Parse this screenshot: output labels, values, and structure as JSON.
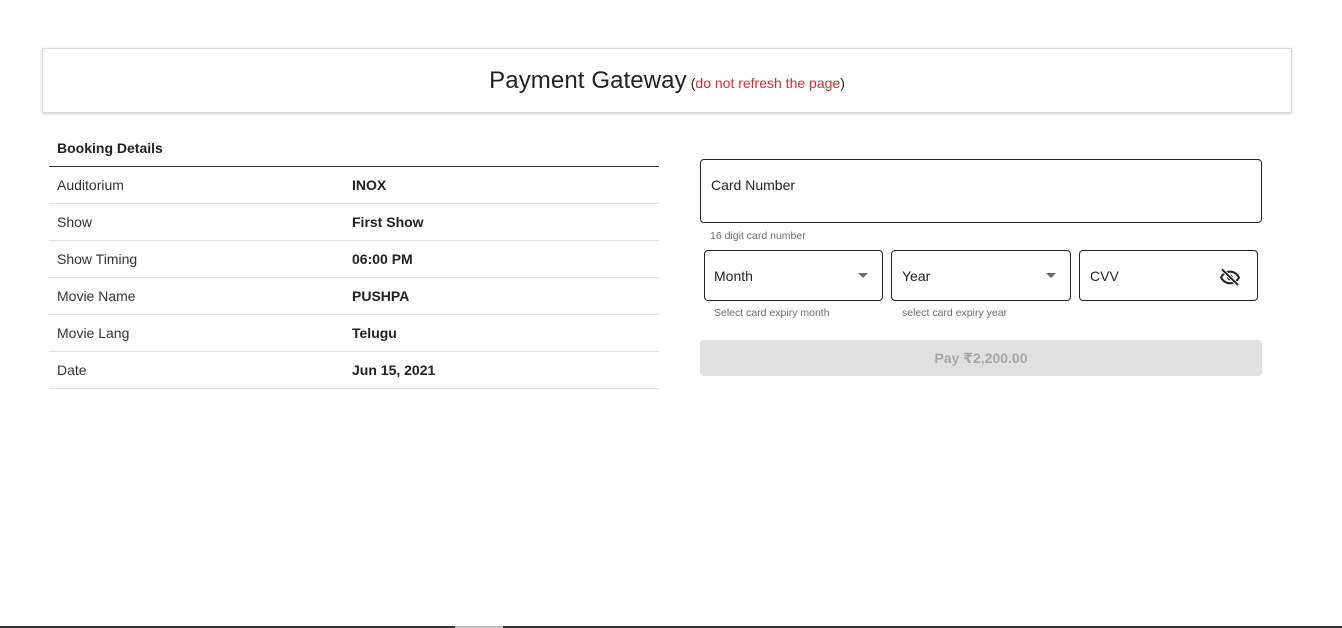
{
  "header": {
    "title": "Payment Gateway",
    "note_open": "(",
    "note_warning": "do not refresh the page",
    "note_close": ")"
  },
  "booking": {
    "heading": "Booking Details",
    "rows": [
      {
        "label": "Auditorium",
        "value": "INOX"
      },
      {
        "label": "Show",
        "value": "First Show"
      },
      {
        "label": "Show Timing",
        "value": "06:00 PM"
      },
      {
        "label": "Movie Name",
        "value": "PUSHPA"
      },
      {
        "label": "Movie Lang",
        "value": "Telugu"
      },
      {
        "label": "Date",
        "value": "Jun 15, 2021"
      }
    ]
  },
  "payment": {
    "card_number_label": "Card Number",
    "card_number_hint": "16 digit card number",
    "month_label": "Month",
    "month_hint": "Select card expiry month",
    "year_label": "Year",
    "year_hint": "select card expiry year",
    "cvv_label": "CVV",
    "cvv_icon": "visibility-off-icon",
    "pay_button": "Pay ₹2,200.00",
    "pay_button_disabled": true
  },
  "colors": {
    "warning": "#d32f2f",
    "disabled_button_bg": "#e0e0e0",
    "disabled_button_text": "#a6a6a6"
  }
}
